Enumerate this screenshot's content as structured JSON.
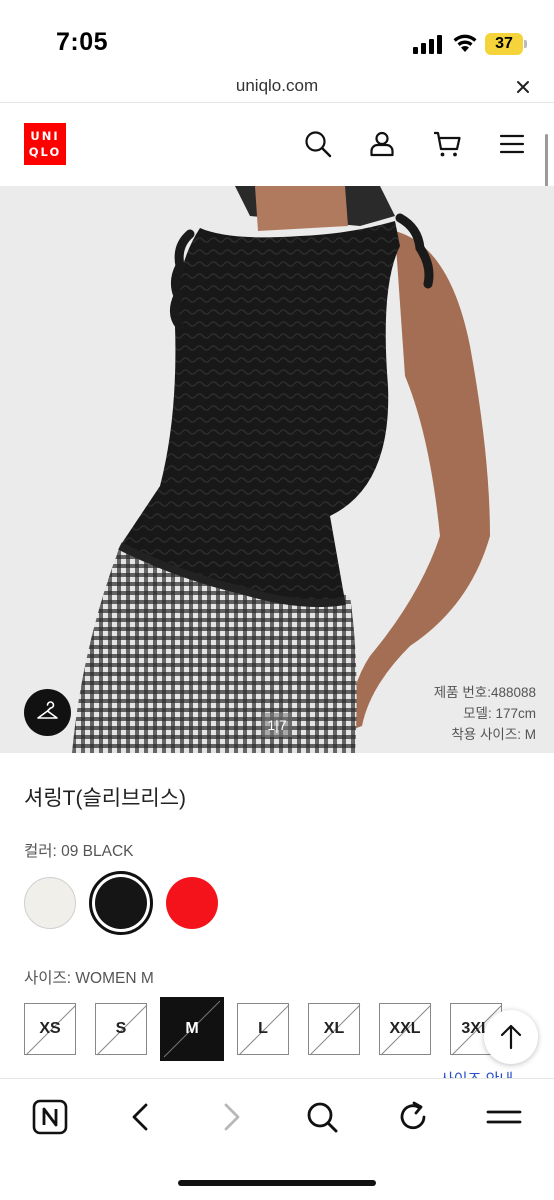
{
  "status_bar": {
    "time": "7:05",
    "battery": "37"
  },
  "browser": {
    "url": "uniqlo.com"
  },
  "header": {
    "logo_line1": "UNI",
    "logo_line2": "QLO"
  },
  "hero": {
    "page_indicator": "1|7",
    "product_number": "제품 번호:488088",
    "model": "모델: 177cm",
    "wear_size": "착용 사이즈: M"
  },
  "product": {
    "name": "셔링T(슬리브리스)",
    "color_label": "컬러: 09 BLACK",
    "colors": [
      {
        "name": "white",
        "hex": "#f1efea",
        "selected": false
      },
      {
        "name": "black",
        "hex": "#151515",
        "selected": true
      },
      {
        "name": "red",
        "hex": "#f4121b",
        "selected": false
      }
    ],
    "size_label": "사이즈: WOMEN M",
    "sizes": [
      {
        "label": "XS",
        "selected": false
      },
      {
        "label": "S",
        "selected": false
      },
      {
        "label": "M",
        "selected": true
      },
      {
        "label": "L",
        "selected": false
      },
      {
        "label": "XL",
        "selected": false
      },
      {
        "label": "XXL",
        "selected": false
      },
      {
        "label": "3XL",
        "selected": false
      }
    ],
    "size_guide": "사이즈 안내"
  }
}
